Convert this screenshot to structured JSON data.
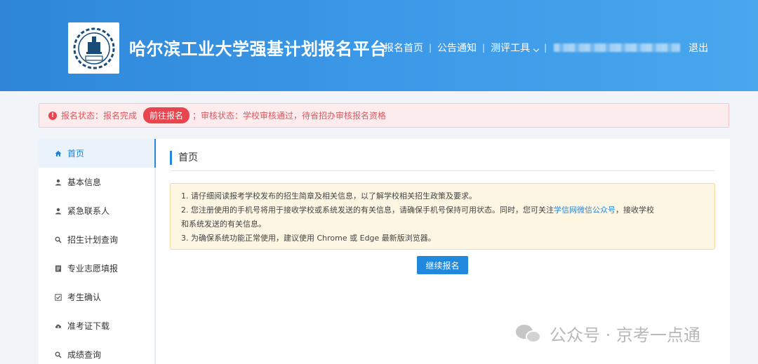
{
  "header": {
    "title": "哈尔滨工业大学强基计划报名平台",
    "nav": {
      "home": "报名首页",
      "notice": "公告通知",
      "tools": "测评工具",
      "logout": "退出"
    }
  },
  "alert": {
    "status_text": "报名状态：报名完成",
    "button_label": "前往报名",
    "review_text": "；审核状态：学校审核通过，待省招办审核报名资格"
  },
  "sidebar": {
    "items": [
      {
        "label": "首页",
        "icon": "home-icon"
      },
      {
        "label": "基本信息",
        "icon": "user-icon"
      },
      {
        "label": "紧急联系人",
        "icon": "user-icon"
      },
      {
        "label": "招生计划查询",
        "icon": "search-icon"
      },
      {
        "label": "专业志愿填报",
        "icon": "form-icon"
      },
      {
        "label": "考生确认",
        "icon": "check-square-icon"
      },
      {
        "label": "准考证下载",
        "icon": "cloud-download-icon"
      },
      {
        "label": "成绩查询",
        "icon": "search-icon"
      }
    ]
  },
  "main": {
    "title": "首页",
    "notice": {
      "line1": "1. 请仔细阅读报考学校发布的招生简章及相关信息，以了解学校相关招生政策及要求。",
      "line2_before": "2. 您注册使用的手机号将用于接收学校或系统发送的有关信息，请确保手机号保持可用状态。同时，您可关注",
      "line2_link": "学信网微信公众号",
      "line2_after": "，接收学校",
      "line2_cont": "和系统发送的有关信息。",
      "line3": "3. 为确保系统功能正常使用，建议使用 Chrome 或 Edge 最新版浏览器。"
    },
    "continue_button": "继续报名"
  },
  "watermark": {
    "text": "公众号 · 京考一点通"
  },
  "colors": {
    "header_blue": "#3a97e6",
    "accent_blue": "#2088dd",
    "alert_red": "#e9454f",
    "notice_bg": "#fdf6e3"
  }
}
